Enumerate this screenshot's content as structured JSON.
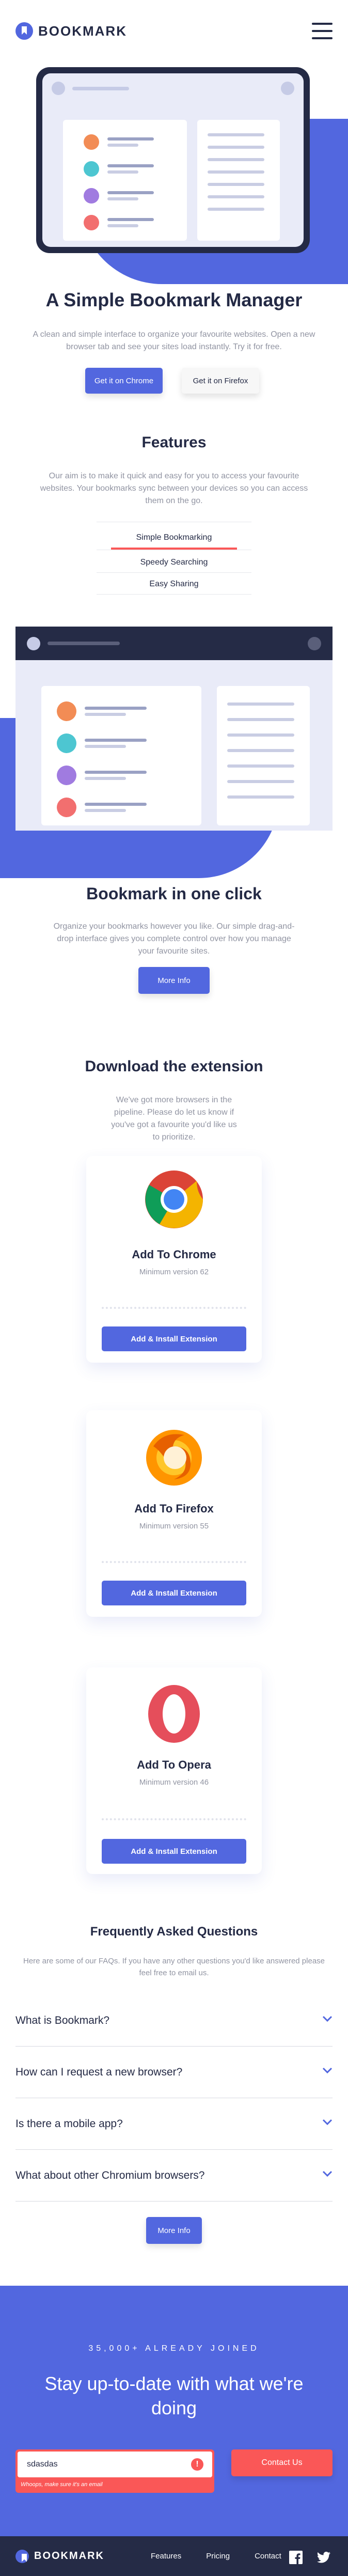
{
  "brand": {
    "name": "BOOKMARK"
  },
  "hero": {
    "title": "A Simple Bookmark Manager",
    "text": "A clean and simple interface to organize your favourite websites. Open a new browser tab and see your sites load instantly. Try it for free.",
    "btn_chrome": "Get it on Chrome",
    "btn_firefox": "Get it on Firefox"
  },
  "features": {
    "title": "Features",
    "text": "Our aim is to make it quick and easy for you to access your favourite websites. Your bookmarks sync between your devices so you can access them on the go.",
    "tabs": [
      "Simple Bookmarking",
      "Speedy Searching",
      "Easy Sharing"
    ],
    "active_tab": "Simple Bookmarking",
    "panel_title": "Bookmark in one click",
    "panel_text": "Organize your bookmarks however you like. Our simple drag-and-drop interface gives you complete control over how you manage your favourite sites.",
    "more_info": "More Info"
  },
  "download": {
    "title": "Download the extension",
    "text": "We've got more browsers in the pipeline. Please do let us know if you've got a favourite you'd like us to prioritize.",
    "cards": [
      {
        "title": "Add To Chrome",
        "sub": "Minimum version 62",
        "button": "Add & Install Extension",
        "icon": "chrome-icon"
      },
      {
        "title": "Add To Firefox",
        "sub": "Minimum version 55",
        "button": "Add & Install Extension",
        "icon": "firefox-icon"
      },
      {
        "title": "Add To Opera",
        "sub": "Minimum version 46",
        "button": "Add & Install Extension",
        "icon": "opera-icon"
      }
    ]
  },
  "faq": {
    "title": "Frequently Asked Questions",
    "text": "Here are some of our FAQs. If you have any other questions you'd like answered please feel free to email us.",
    "items": [
      "What is Bookmark?",
      "How can I request a new browser?",
      "Is there a mobile app?",
      "What about other Chromium browsers?"
    ],
    "more_info": "More Info"
  },
  "newsletter": {
    "kicker": "35,000+ ALREADY JOINED",
    "title": "Stay up-to-date with what we're doing",
    "input_value": "sdasdas",
    "error": "Whoops, make sure it's an email",
    "button": "Contact Us"
  },
  "footer": {
    "links": [
      "Features",
      "Pricing",
      "Contact"
    ]
  },
  "colors": {
    "primary": "#5267DF",
    "accent": "#FA5757",
    "dark": "#252B46",
    "muted": "#9194A2"
  }
}
